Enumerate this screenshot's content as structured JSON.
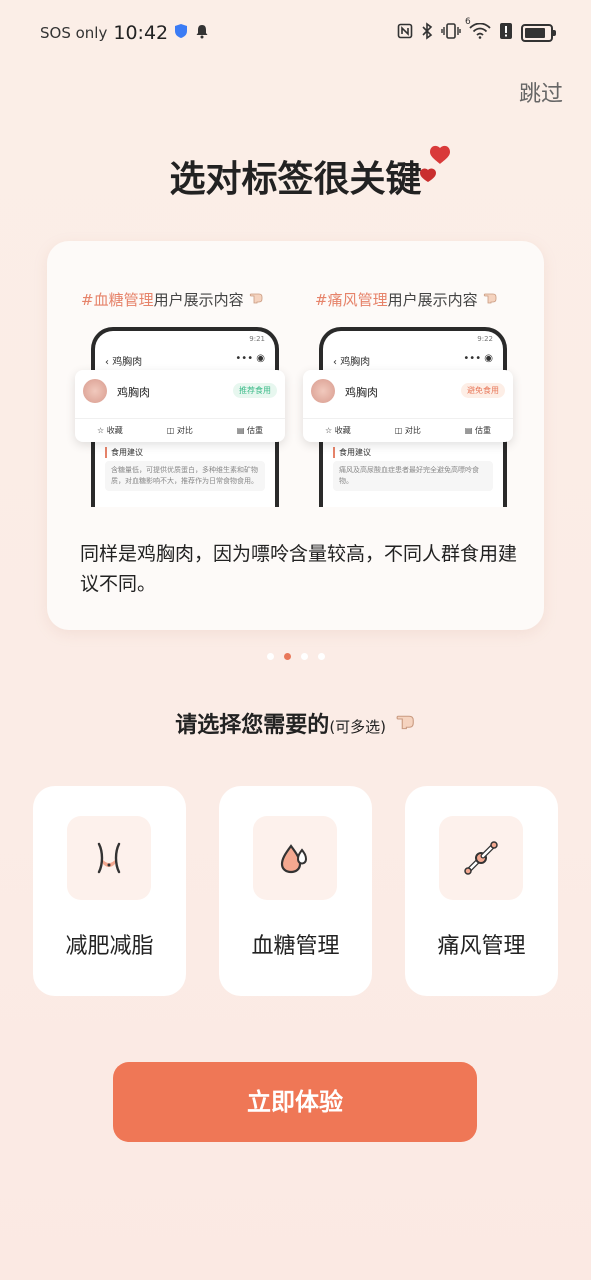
{
  "status_bar": {
    "sos": "SOS only",
    "time": "10:42",
    "network": "6"
  },
  "skip_label": "跳过",
  "title": "选对标签很关键",
  "card": {
    "left_demo": {
      "tag": "#血糖管理",
      "caption_suffix": "用户展示内容",
      "phone_time": "9:21",
      "page_title": "鸡胸肉",
      "food_name": "鸡胸肉",
      "badge": "推荐食用",
      "actions": [
        "收藏",
        "对比",
        "估重"
      ],
      "section": "食用建议",
      "text": "含糖量低，可提供优质蛋白，多种维生素和矿物质，对血糖影响不大，推荐作为日常食物食用。"
    },
    "right_demo": {
      "tag": "#痛风管理",
      "caption_suffix": "用户展示内容",
      "phone_time": "9:22",
      "page_title": "鸡胸肉",
      "food_name": "鸡胸肉",
      "badge": "避免食用",
      "actions": [
        "收藏",
        "对比",
        "估重"
      ],
      "section": "食用建议",
      "text": "痛风及高尿酸血症患者最好完全避免高嘌呤食物。"
    },
    "description": "同样是鸡胸肉，因为嘌呤含量较高，不同人群食用建议不同。"
  },
  "carousel": {
    "count": 4,
    "active": 1
  },
  "select_title": "请选择您需要的",
  "select_subtitle": "(可多选)",
  "options": [
    {
      "label": "减肥减脂",
      "icon": "waist-icon"
    },
    {
      "label": "血糖管理",
      "icon": "blood-drop-icon"
    },
    {
      "label": "痛风管理",
      "icon": "joint-bone-icon"
    }
  ],
  "cta_label": "立即体验",
  "colors": {
    "accent": "#ef7756",
    "tag": "#e6836a",
    "recommend": "#3dbb8a",
    "avoid": "#e8785a"
  }
}
